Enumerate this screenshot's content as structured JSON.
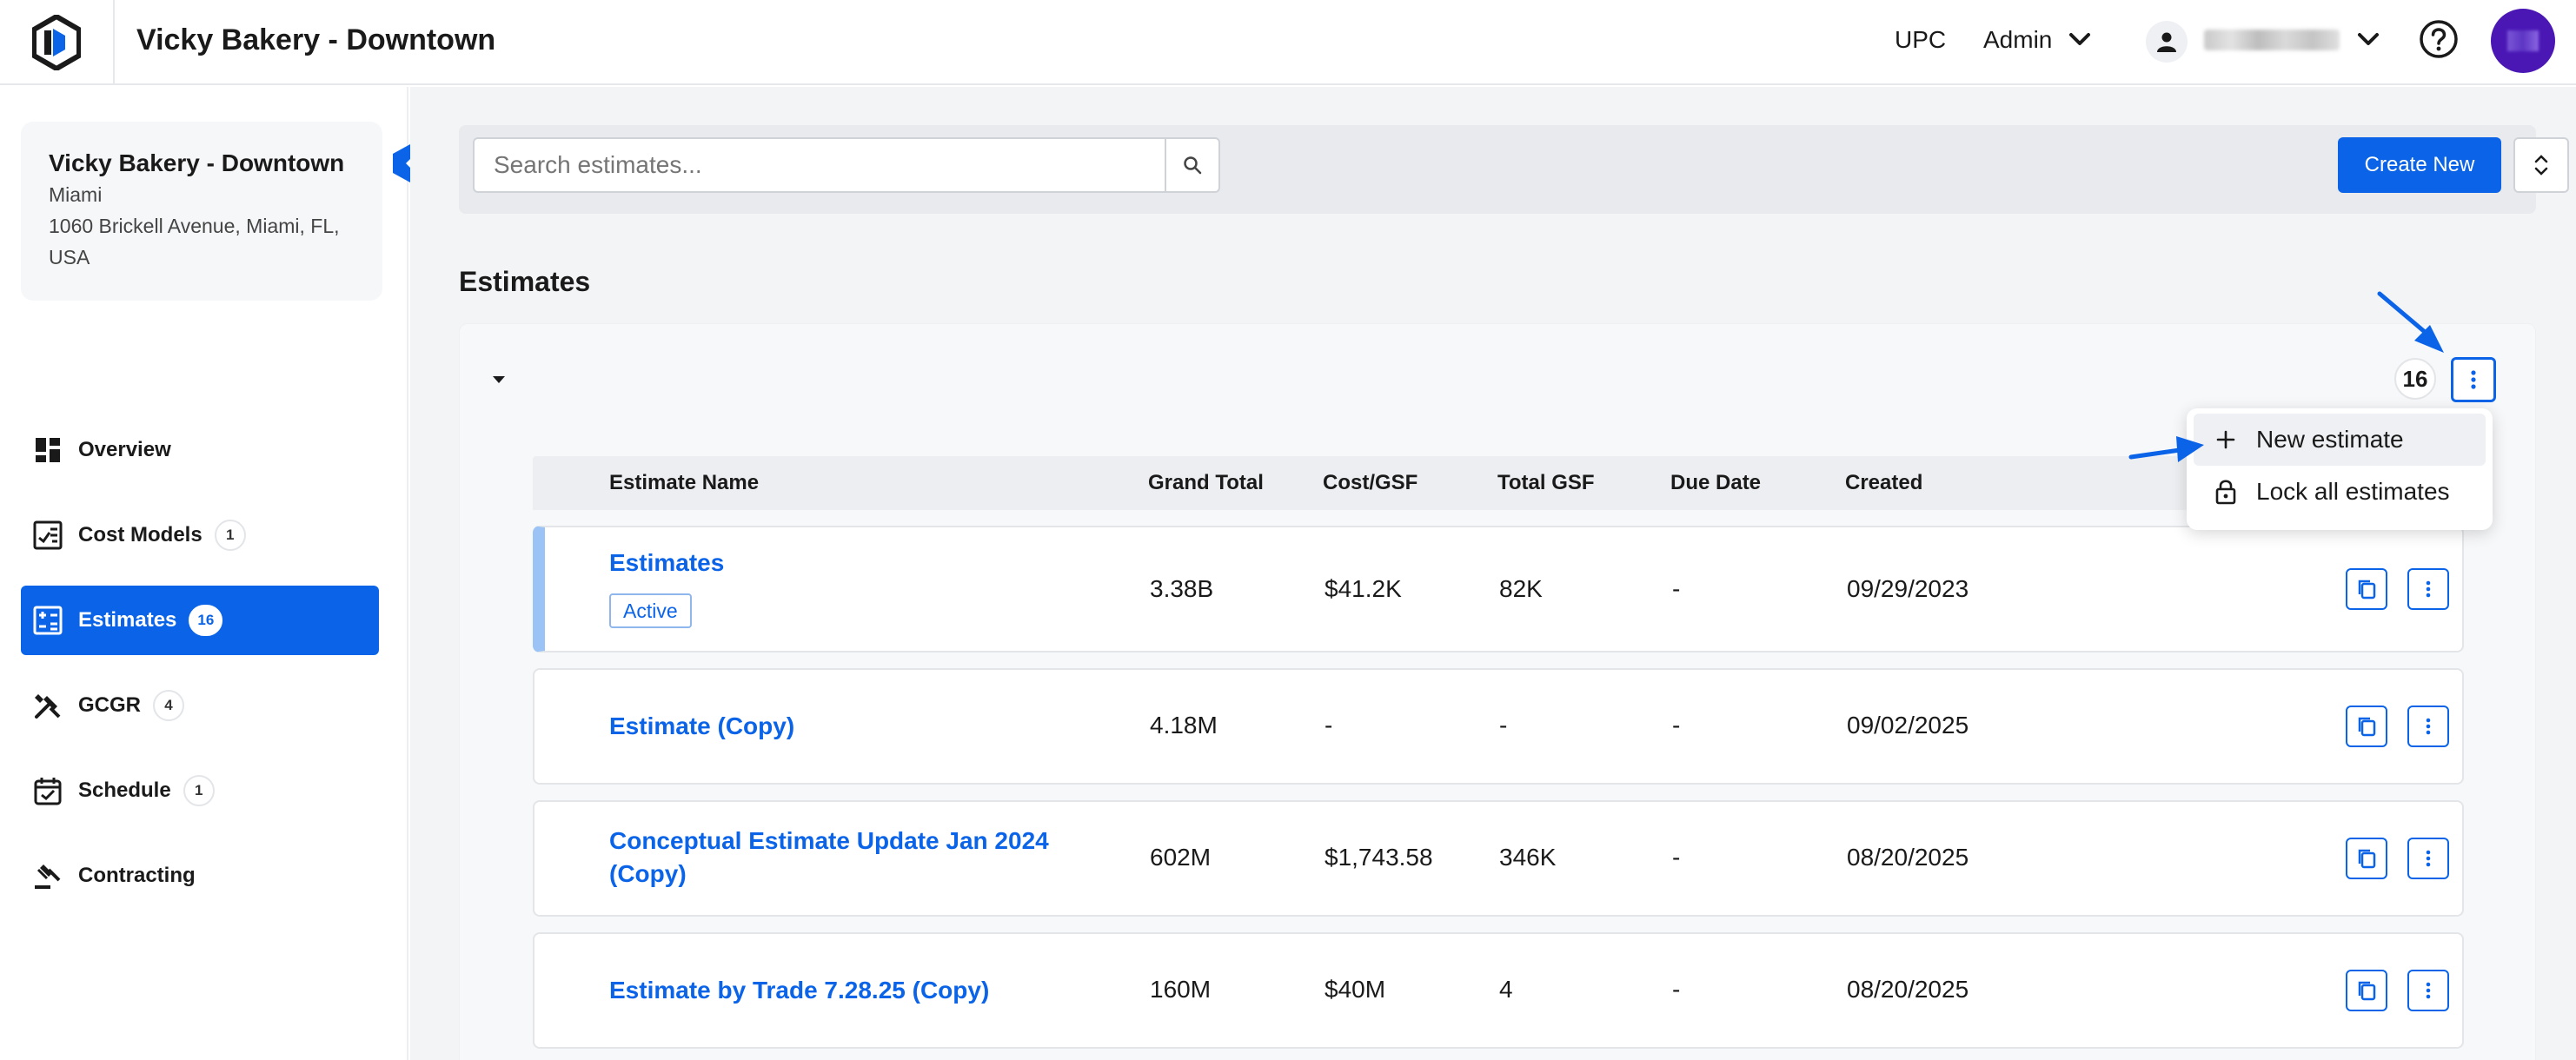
{
  "header": {
    "title": "Vicky Bakery - Downtown",
    "upc": "UPC",
    "admin": "Admin"
  },
  "sidebar": {
    "location": {
      "name": "Vicky Bakery - Downtown",
      "city": "Miami",
      "address": "1060 Brickell Avenue, Miami, FL, USA"
    },
    "items": [
      {
        "label": "Overview",
        "badge": "",
        "icon": "dashboard-icon"
      },
      {
        "label": "Cost Models",
        "badge": "1",
        "icon": "chart-icon"
      },
      {
        "label": "Estimates",
        "badge": "16",
        "icon": "calculator-icon",
        "active": true
      },
      {
        "label": "GCGR",
        "badge": "4",
        "icon": "tools-icon"
      },
      {
        "label": "Schedule",
        "badge": "1",
        "icon": "calendar-icon"
      },
      {
        "label": "Contracting",
        "badge": "",
        "icon": "gavel-icon"
      }
    ]
  },
  "toolbar": {
    "search_placeholder": "Search estimates...",
    "create_label": "Create New"
  },
  "section": {
    "title": "Estimates",
    "count": "16"
  },
  "table": {
    "columns": [
      "Estimate Name",
      "Grand Total",
      "Cost/GSF",
      "Total GSF",
      "Due Date",
      "Created"
    ],
    "rows": [
      {
        "name": "Estimates",
        "status": "Active",
        "grand_total": "3.38B",
        "cost_gsf": "$41.2K",
        "total_gsf": "82K",
        "due_date": "-",
        "created": "09/29/2023"
      },
      {
        "name": "Estimate (Copy)",
        "grand_total": "4.18M",
        "cost_gsf": "-",
        "total_gsf": "-",
        "due_date": "-",
        "created": "09/02/2025"
      },
      {
        "name_line1": "Conceptual Estimate Update Jan 2024",
        "name_line2": "(Copy)",
        "grand_total": "602M",
        "cost_gsf": "$1,743.58",
        "total_gsf": "346K",
        "due_date": "-",
        "created": "08/20/2025"
      },
      {
        "name": "Estimate by Trade 7.28.25 (Copy)",
        "grand_total": "160M",
        "cost_gsf": "$40M",
        "total_gsf": "4",
        "due_date": "-",
        "created": "08/20/2025"
      }
    ]
  },
  "menu": {
    "items": [
      {
        "label": "New estimate",
        "icon": "plus-icon"
      },
      {
        "label": "Lock all estimates",
        "icon": "lock-icon"
      }
    ]
  },
  "colors": {
    "accent": "#0b64e8",
    "avatar": "#4a17b5",
    "active_row_bar": "#9cc3f5"
  }
}
